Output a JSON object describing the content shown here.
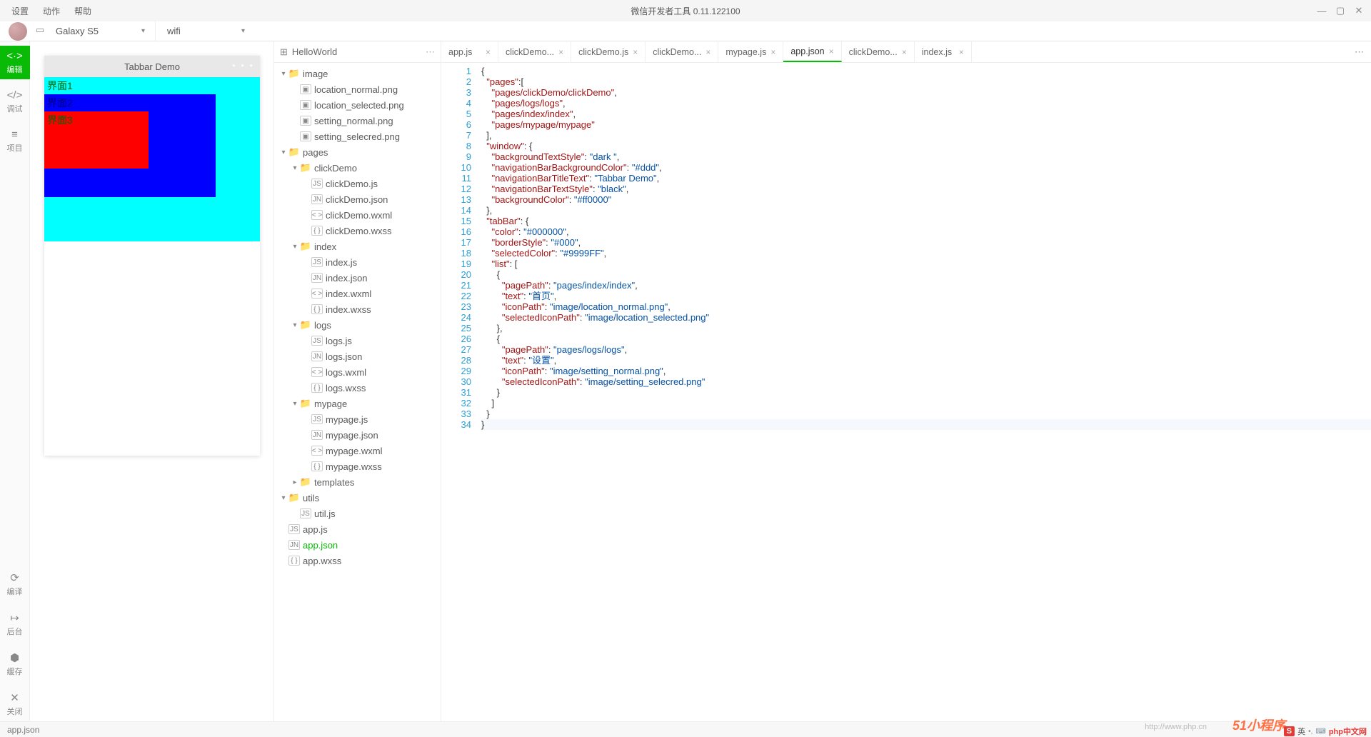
{
  "menu": {
    "settings": "设置",
    "action": "动作",
    "help": "帮助"
  },
  "title": "微信开发者工具 0.11.122100",
  "toolbar": {
    "device": "Galaxy S5",
    "network": "wifi"
  },
  "leftbar": {
    "edit": "编辑",
    "debug": "调试",
    "project": "项目",
    "compile": "编译",
    "background": "后台",
    "cache": "缓存",
    "close": "关闭"
  },
  "preview": {
    "title": "Tabbar Demo",
    "row1": "界面1",
    "row2": "界面2",
    "row3": "界面3"
  },
  "project_name": "HelloWorld",
  "tree": [
    {
      "depth": 0,
      "type": "folder",
      "caret": "▾",
      "label": "image"
    },
    {
      "depth": 1,
      "type": "img",
      "label": "location_normal.png"
    },
    {
      "depth": 1,
      "type": "img",
      "label": "location_selected.png"
    },
    {
      "depth": 1,
      "type": "img",
      "label": "setting_normal.png"
    },
    {
      "depth": 1,
      "type": "img",
      "label": "setting_selecred.png"
    },
    {
      "depth": 0,
      "type": "folder",
      "caret": "▾",
      "label": "pages"
    },
    {
      "depth": 1,
      "type": "folder",
      "caret": "▾",
      "label": "clickDemo"
    },
    {
      "depth": 2,
      "type": "js",
      "label": "clickDemo.js"
    },
    {
      "depth": 2,
      "type": "json",
      "label": "clickDemo.json"
    },
    {
      "depth": 2,
      "type": "wxml",
      "label": "clickDemo.wxml"
    },
    {
      "depth": 2,
      "type": "wxss",
      "label": "clickDemo.wxss"
    },
    {
      "depth": 1,
      "type": "folder",
      "caret": "▾",
      "label": "index"
    },
    {
      "depth": 2,
      "type": "js",
      "label": "index.js"
    },
    {
      "depth": 2,
      "type": "json",
      "label": "index.json"
    },
    {
      "depth": 2,
      "type": "wxml",
      "label": "index.wxml"
    },
    {
      "depth": 2,
      "type": "wxss",
      "label": "index.wxss"
    },
    {
      "depth": 1,
      "type": "folder",
      "caret": "▾",
      "label": "logs"
    },
    {
      "depth": 2,
      "type": "js",
      "label": "logs.js"
    },
    {
      "depth": 2,
      "type": "json",
      "label": "logs.json"
    },
    {
      "depth": 2,
      "type": "wxml",
      "label": "logs.wxml"
    },
    {
      "depth": 2,
      "type": "wxss",
      "label": "logs.wxss"
    },
    {
      "depth": 1,
      "type": "folder",
      "caret": "▾",
      "label": "mypage"
    },
    {
      "depth": 2,
      "type": "js",
      "label": "mypage.js"
    },
    {
      "depth": 2,
      "type": "json",
      "label": "mypage.json"
    },
    {
      "depth": 2,
      "type": "wxml",
      "label": "mypage.wxml"
    },
    {
      "depth": 2,
      "type": "wxss",
      "label": "mypage.wxss"
    },
    {
      "depth": 1,
      "type": "folder",
      "caret": "▸",
      "label": "templates"
    },
    {
      "depth": 0,
      "type": "folder",
      "caret": "▾",
      "label": "utils"
    },
    {
      "depth": 1,
      "type": "js",
      "label": "util.js"
    },
    {
      "depth": 0,
      "type": "js",
      "label": "app.js"
    },
    {
      "depth": 0,
      "type": "json",
      "label": "app.json",
      "sel": true
    },
    {
      "depth": 0,
      "type": "wxss",
      "label": "app.wxss"
    }
  ],
  "tabs": [
    {
      "label": "app.js"
    },
    {
      "label": "clickDemo..."
    },
    {
      "label": "clickDemo.js"
    },
    {
      "label": "clickDemo..."
    },
    {
      "label": "mypage.js"
    },
    {
      "label": "app.json",
      "active": true
    },
    {
      "label": "clickDemo..."
    },
    {
      "label": "index.js"
    }
  ],
  "code_lines": [
    [
      [
        "p",
        "{"
      ]
    ],
    [
      [
        "p",
        "  "
      ],
      [
        "k",
        "\"pages\""
      ],
      [
        "p",
        ":["
      ]
    ],
    [
      [
        "p",
        "    "
      ],
      [
        "k",
        "\"pages/clickDemo/clickDemo\""
      ],
      [
        "p",
        ","
      ]
    ],
    [
      [
        "p",
        "    "
      ],
      [
        "k",
        "\"pages/logs/logs\""
      ],
      [
        "p",
        ","
      ]
    ],
    [
      [
        "p",
        "    "
      ],
      [
        "k",
        "\"pages/index/index\""
      ],
      [
        "p",
        ","
      ]
    ],
    [
      [
        "p",
        "    "
      ],
      [
        "k",
        "\"pages/mypage/mypage\""
      ]
    ],
    [
      [
        "p",
        "  ],"
      ]
    ],
    [
      [
        "p",
        "  "
      ],
      [
        "k",
        "\"window\""
      ],
      [
        "p",
        ": {"
      ]
    ],
    [
      [
        "p",
        "    "
      ],
      [
        "k",
        "\"backgroundTextStyle\""
      ],
      [
        "p",
        ": "
      ],
      [
        "v",
        "\"dark \""
      ],
      [
        "p",
        ","
      ]
    ],
    [
      [
        "p",
        "    "
      ],
      [
        "k",
        "\"navigationBarBackgroundColor\""
      ],
      [
        "p",
        ": "
      ],
      [
        "v",
        "\"#ddd\""
      ],
      [
        "p",
        ","
      ]
    ],
    [
      [
        "p",
        "    "
      ],
      [
        "k",
        "\"navigationBarTitleText\""
      ],
      [
        "p",
        ": "
      ],
      [
        "v",
        "\"Tabbar Demo\""
      ],
      [
        "p",
        ","
      ]
    ],
    [
      [
        "p",
        "    "
      ],
      [
        "k",
        "\"navigationBarTextStyle\""
      ],
      [
        "p",
        ": "
      ],
      [
        "v",
        "\"black\""
      ],
      [
        "p",
        ","
      ]
    ],
    [
      [
        "p",
        "    "
      ],
      [
        "k",
        "\"backgroundColor\""
      ],
      [
        "p",
        ": "
      ],
      [
        "v",
        "\"#ff0000\""
      ]
    ],
    [
      [
        "p",
        "  },"
      ]
    ],
    [
      [
        "p",
        "  "
      ],
      [
        "k",
        "\"tabBar\""
      ],
      [
        "p",
        ": {"
      ]
    ],
    [
      [
        "p",
        "    "
      ],
      [
        "k",
        "\"color\""
      ],
      [
        "p",
        ": "
      ],
      [
        "v",
        "\"#000000\""
      ],
      [
        "p",
        ","
      ]
    ],
    [
      [
        "p",
        "    "
      ],
      [
        "k",
        "\"borderStyle\""
      ],
      [
        "p",
        ": "
      ],
      [
        "v",
        "\"#000\""
      ],
      [
        "p",
        ","
      ]
    ],
    [
      [
        "p",
        "    "
      ],
      [
        "k",
        "\"selectedColor\""
      ],
      [
        "p",
        ": "
      ],
      [
        "v",
        "\"#9999FF\""
      ],
      [
        "p",
        ","
      ]
    ],
    [
      [
        "p",
        "    "
      ],
      [
        "k",
        "\"list\""
      ],
      [
        "p",
        ": ["
      ]
    ],
    [
      [
        "p",
        "      {"
      ]
    ],
    [
      [
        "p",
        "        "
      ],
      [
        "k",
        "\"pagePath\""
      ],
      [
        "p",
        ": "
      ],
      [
        "v",
        "\"pages/index/index\""
      ],
      [
        "p",
        ","
      ]
    ],
    [
      [
        "p",
        "        "
      ],
      [
        "k",
        "\"text\""
      ],
      [
        "p",
        ": "
      ],
      [
        "v",
        "\"首页\""
      ],
      [
        "p",
        ","
      ]
    ],
    [
      [
        "p",
        "        "
      ],
      [
        "k",
        "\"iconPath\""
      ],
      [
        "p",
        ": "
      ],
      [
        "v",
        "\"image/location_normal.png\""
      ],
      [
        "p",
        ","
      ]
    ],
    [
      [
        "p",
        "        "
      ],
      [
        "k",
        "\"selectedIconPath\""
      ],
      [
        "p",
        ": "
      ],
      [
        "v",
        "\"image/location_selected.png\""
      ]
    ],
    [
      [
        "p",
        "      },"
      ]
    ],
    [
      [
        "p",
        "      {"
      ]
    ],
    [
      [
        "p",
        "        "
      ],
      [
        "k",
        "\"pagePath\""
      ],
      [
        "p",
        ": "
      ],
      [
        "v",
        "\"pages/logs/logs\""
      ],
      [
        "p",
        ","
      ]
    ],
    [
      [
        "p",
        "        "
      ],
      [
        "k",
        "\"text\""
      ],
      [
        "p",
        ": "
      ],
      [
        "v",
        "\"设置\""
      ],
      [
        "p",
        ","
      ]
    ],
    [
      [
        "p",
        "        "
      ],
      [
        "k",
        "\"iconPath\""
      ],
      [
        "p",
        ": "
      ],
      [
        "v",
        "\"image/setting_normal.png\""
      ],
      [
        "p",
        ","
      ]
    ],
    [
      [
        "p",
        "        "
      ],
      [
        "k",
        "\"selectedIconPath\""
      ],
      [
        "p",
        ": "
      ],
      [
        "v",
        "\"image/setting_selecred.png\""
      ]
    ],
    [
      [
        "p",
        "      }"
      ]
    ],
    [
      [
        "p",
        "    ]"
      ]
    ],
    [
      [
        "p",
        "  }"
      ]
    ],
    [
      [
        "p",
        "}"
      ]
    ]
  ],
  "status_file": "app.json",
  "ime": "英",
  "watermark_url": "http://www.php.cn",
  "watermark_text1": "51小程序",
  "watermark_text2": "php中文网"
}
